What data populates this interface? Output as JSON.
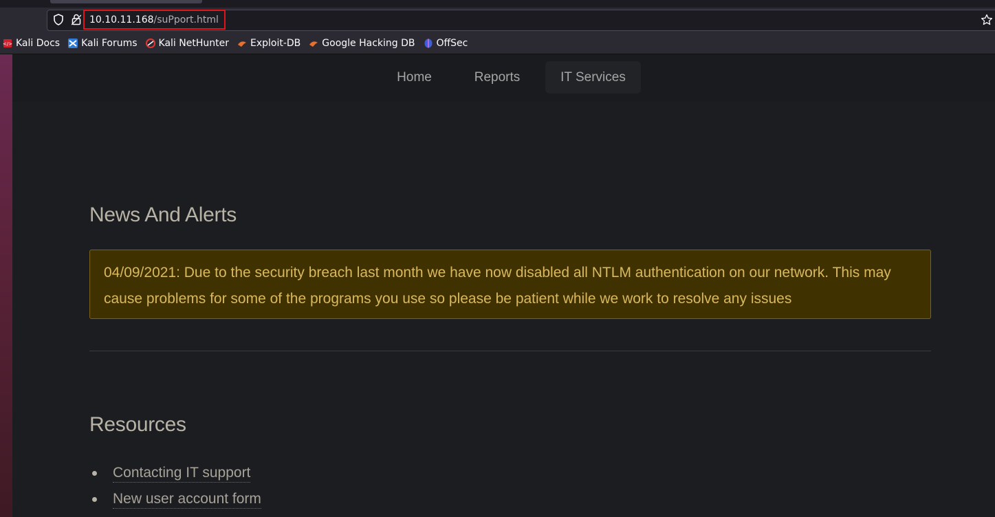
{
  "browser": {
    "url_host": "10.10.11.168",
    "url_path": "/suPport.html",
    "bookmarks": [
      {
        "label": "Kali Docs",
        "icon": "kali-docs-icon"
      },
      {
        "label": "Kali Forums",
        "icon": "kali-forums-icon"
      },
      {
        "label": "Kali NetHunter",
        "icon": "kali-nethunter-icon"
      },
      {
        "label": "Exploit-DB",
        "icon": "exploit-db-icon"
      },
      {
        "label": "Google Hacking DB",
        "icon": "ghdb-icon"
      },
      {
        "label": "OffSec",
        "icon": "offsec-icon"
      }
    ]
  },
  "nav": {
    "home": "Home",
    "reports": "Reports",
    "it_services": "IT Services"
  },
  "news": {
    "title": "News And Alerts",
    "alert": "04/09/2021: Due to the security breach last month we have now disabled all NTLM authentication on our network. This may cause problems for some of the programs you use so please be patient while we work to resolve any issues"
  },
  "resources": {
    "title": "Resources",
    "items": [
      {
        "label": "Contacting IT support"
      },
      {
        "label": "New user account form"
      }
    ]
  },
  "colors": {
    "alert_bg": "#3f3100",
    "alert_text": "#d9b85f",
    "url_highlight": "#e0151b"
  }
}
